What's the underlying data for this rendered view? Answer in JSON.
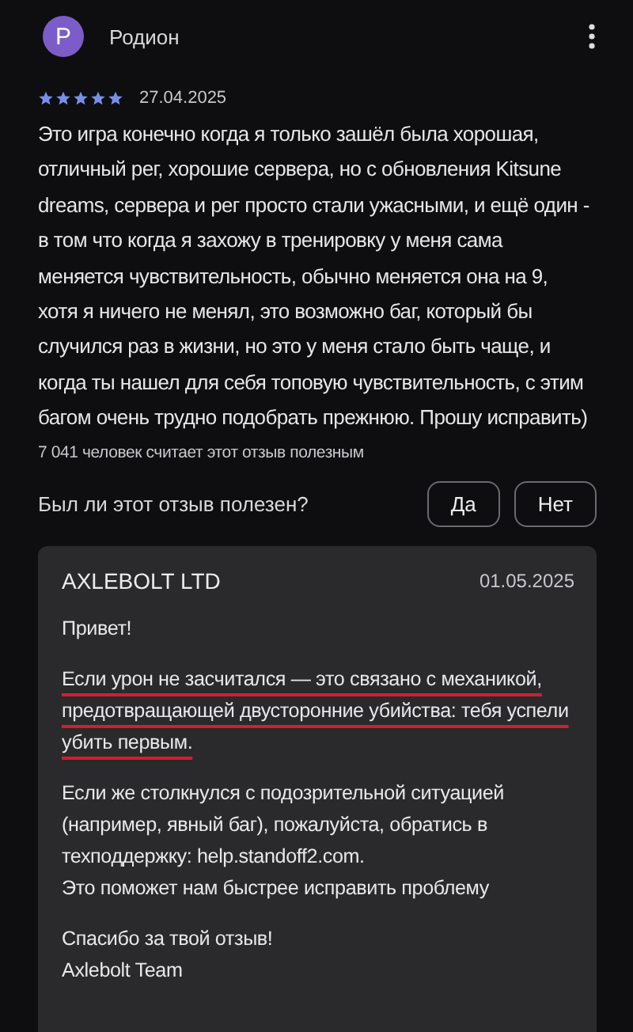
{
  "review": {
    "avatar_letter": "P",
    "author": "Родион",
    "stars": 5,
    "date": "27.04.2025",
    "text": "Это игра конечно когда я только зашёл была хорошая, отличный рег, хорошие сервера, но с обновления Kitsune dreams, сервера и рег просто стали ужасными, и ещё один - в том что когда я захожу в тренировку у меня сама меняется чувствительность, обычно меняется она на 9, хотя я ничего не менял, это возможно баг, который бы случился раз в жизни, но это у меня стало быть чаще, и когда ты нашел для себя топовую чувствительность, с этим багом очень трудно подобрать прежнюю. Прошу исправить)",
    "helpful_count": "7 041 человек считает этот отзыв полезным"
  },
  "feedback": {
    "question": "Был ли этот отзыв полезен?",
    "buttons": [
      "Да",
      "Нет"
    ]
  },
  "reply": {
    "developer": "AXLEBOLT LTD",
    "date": "01.05.2025",
    "paragraphs": [
      {
        "lines": [
          "Привет!"
        ],
        "underlined": false
      },
      {
        "lines": [
          "Если урон не засчитался — это связано с механикой, предотвращающей двусторонние убийства: тебя успели убить первым."
        ],
        "underlined": true
      },
      {
        "lines": [
          "Если же столкнулся с подозрительной ситуацией (например, явный баг), пожалуйста, обратись в техподдержку: help.standoff2.com.",
          "Это поможет нам быстрее исправить проблему"
        ],
        "underlined": false
      },
      {
        "lines": [
          "Спасибо за твой отзыв!",
          "Axlebolt Team"
        ],
        "underlined": false
      }
    ]
  }
}
